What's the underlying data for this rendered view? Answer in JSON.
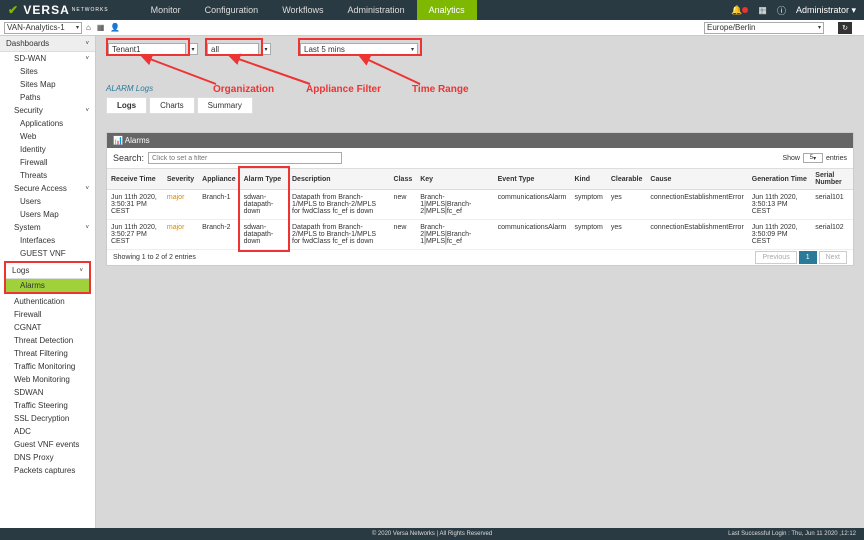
{
  "brand": {
    "name": "VERSA",
    "sub": "NETWORKS"
  },
  "nav": [
    "Monitor",
    "Configuration",
    "Workflows",
    "Administration",
    "Analytics"
  ],
  "nav_active": 4,
  "user": "Administrator",
  "tenant": "VAN-Analytics-1",
  "region": "Europe/Berlin",
  "filters": {
    "org": "Tenant1",
    "appliance": "all",
    "time": "Last 5 mins"
  },
  "annotations": {
    "org": "Organization",
    "app": "Appliance Filter",
    "time": "Time Range"
  },
  "sidebar": {
    "dashboards": "Dashboards",
    "sdwan": "SD-WAN",
    "sdwan_items": [
      "Sites",
      "Sites Map",
      "Paths"
    ],
    "security": "Security",
    "security_items": [
      "Applications",
      "Web",
      "Identity",
      "Firewall",
      "Threats"
    ],
    "secure_access": "Secure Access",
    "sa_items": [
      "Users",
      "Users Map"
    ],
    "system": "System",
    "sys_items": [
      "Interfaces",
      "GUEST VNF"
    ],
    "logs": "Logs",
    "logs_items": [
      "Alarms",
      "Authentication",
      "Firewall",
      "CGNAT",
      "Threat Detection",
      "Threat Filtering",
      "Traffic Monitoring",
      "Web Monitoring",
      "SDWAN",
      "Traffic Steering",
      "SSL Decryption",
      "ADC",
      "Guest VNF events",
      "DNS Proxy",
      "Packets captures"
    ]
  },
  "panel": {
    "title": "ALARM Logs",
    "tabs": [
      "Logs",
      "Charts",
      "Summary"
    ],
    "tab_active": 0,
    "card_title": "Alarms"
  },
  "search": {
    "label": "Search:",
    "placeholder": "Click to set a filter"
  },
  "show": {
    "label": "Show",
    "val": "5",
    "entries": "entries"
  },
  "table": {
    "headers": [
      "Receive Time",
      "Severity",
      "Appliance",
      "Alarm Type",
      "Description",
      "Class",
      "Key",
      "Event Type",
      "Kind",
      "Clearable",
      "Cause",
      "Generation Time",
      "Serial Number"
    ],
    "rows": [
      {
        "time": "Jun 11th 2020, 3:50:31 PM CEST",
        "sev": "major",
        "app": "Branch-1",
        "type": "sdwan-datapath-down",
        "desc": "Datapath from Branch-1/MPLS to Branch-2/MPLS for fwdClass fc_ef is down",
        "class": "new",
        "key": "Branch-1|MPLS|Branch-2|MPLS|fc_ef",
        "etype": "communicationsAlarm",
        "kind": "symptom",
        "clr": "yes",
        "cause": "connectionEstablishmentError",
        "gen": "Jun 11th 2020, 3:50:13 PM CEST",
        "sn": "serial101"
      },
      {
        "time": "Jun 11th 2020, 3:50:27 PM CEST",
        "sev": "major",
        "app": "Branch-2",
        "type": "sdwan-datapath-down",
        "desc": "Datapath from Branch-2/MPLS to Branch-1/MPLS for fwdClass fc_ef is down",
        "class": "new",
        "key": "Branch-2|MPLS|Branch-1|MPLS|fc_ef",
        "etype": "communicationsAlarm",
        "kind": "symptom",
        "clr": "yes",
        "cause": "connectionEstablishmentError",
        "gen": "Jun 11th 2020, 3:50:09 PM CEST",
        "sn": "serial102"
      }
    ],
    "summary": "Showing 1 to 2 of 2 entries",
    "pager": [
      "Previous",
      "1",
      "Next"
    ]
  },
  "footer": {
    "copy": "© 2020 Versa Networks | All Rights Reserved",
    "login": "Last Successful Login : Thu, Jun 11 2020 ,12:12"
  }
}
